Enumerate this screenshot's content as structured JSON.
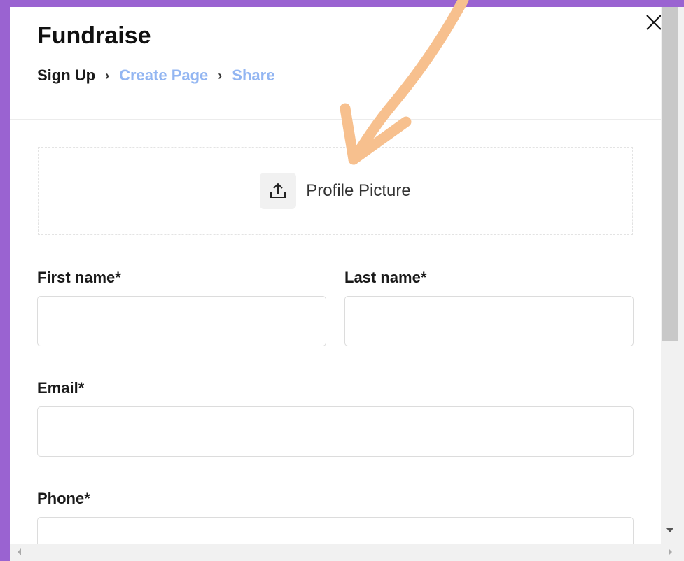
{
  "modal": {
    "title": "Fundraise",
    "close_icon": "close-icon"
  },
  "breadcrumb": {
    "steps": [
      {
        "label": "Sign Up",
        "active": true
      },
      {
        "label": "Create Page",
        "active": false
      },
      {
        "label": "Share",
        "active": false
      }
    ],
    "separator_icon": "chevron-right-icon"
  },
  "upload": {
    "label": "Profile Picture",
    "icon": "upload-icon"
  },
  "form": {
    "first_name": {
      "label": "First name*",
      "value": ""
    },
    "last_name": {
      "label": "Last name*",
      "value": ""
    },
    "email": {
      "label": "Email*",
      "value": ""
    },
    "phone": {
      "label": "Phone*",
      "value": ""
    }
  },
  "colors": {
    "background": "#9a63d1",
    "breadcrumb_inactive": "#93b6f2",
    "annotation_arrow": "#f7c08e"
  }
}
